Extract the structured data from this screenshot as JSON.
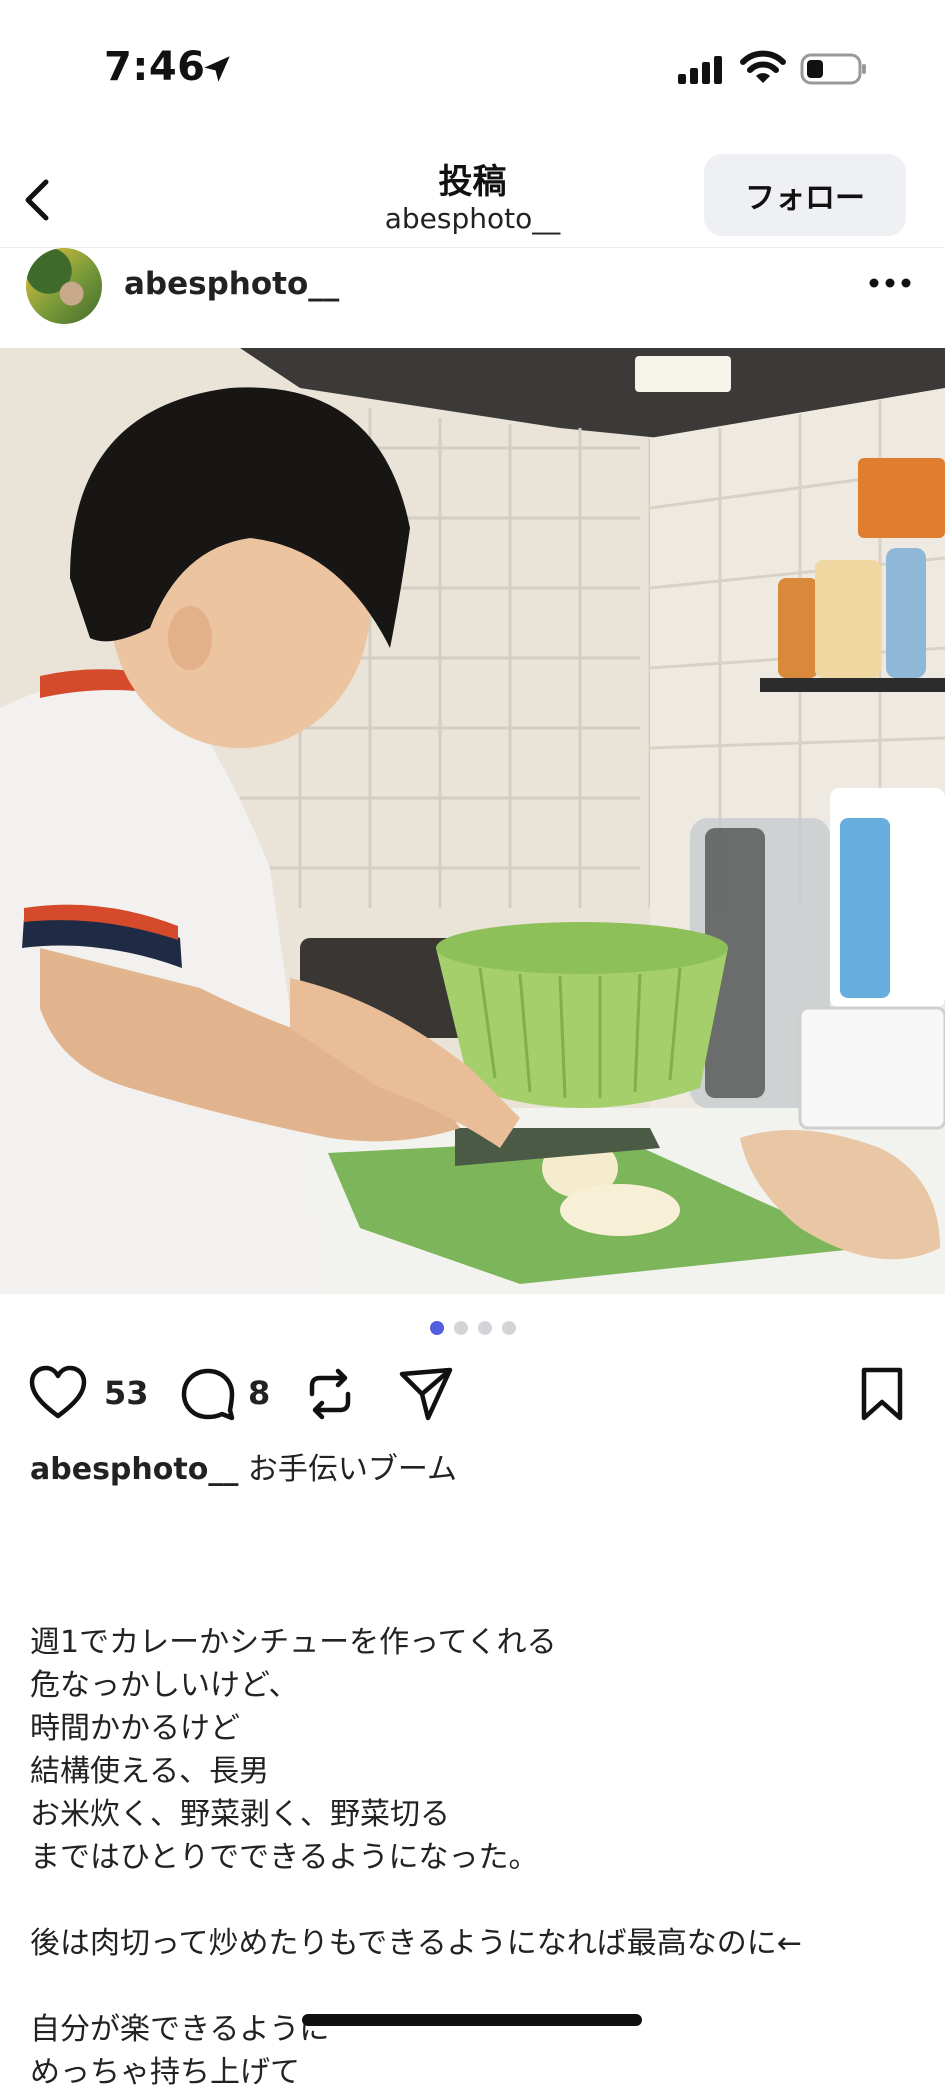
{
  "status_bar": {
    "time": "7:46",
    "icons": [
      "location-arrow-icon",
      "cell-signal-icon",
      "wifi-icon",
      "battery-icon"
    ]
  },
  "header": {
    "title": "投稿",
    "subtitle": "abesphoto__",
    "follow_label": "フォロー",
    "back_icon": "chevron-left-icon"
  },
  "post": {
    "author": "abesphoto__",
    "more_icon": "more-horizontal-icon",
    "carousel": {
      "count": 4,
      "active_index": 0
    },
    "likes": "53",
    "comments": "8",
    "caption_user": "abesphoto__",
    "caption_title": "お手伝いブーム",
    "body_lines": [
      "",
      "週1でカレーかシチューを作ってくれる",
      "危なっかしいけど、",
      "時間かかるけど",
      "結構使える、長男",
      "お米炊く、野菜剥く、野菜切る",
      "まではひとりでできるようになった。",
      "",
      "後は肉切って炒めたりもできるようになれば最高なのに←",
      "",
      "自分が楽できるように",
      "めっちゃ持ち上げて"
    ]
  },
  "colors": {
    "accent_dot": "#4f5fe0",
    "follow_bg": "#eef0f3"
  }
}
